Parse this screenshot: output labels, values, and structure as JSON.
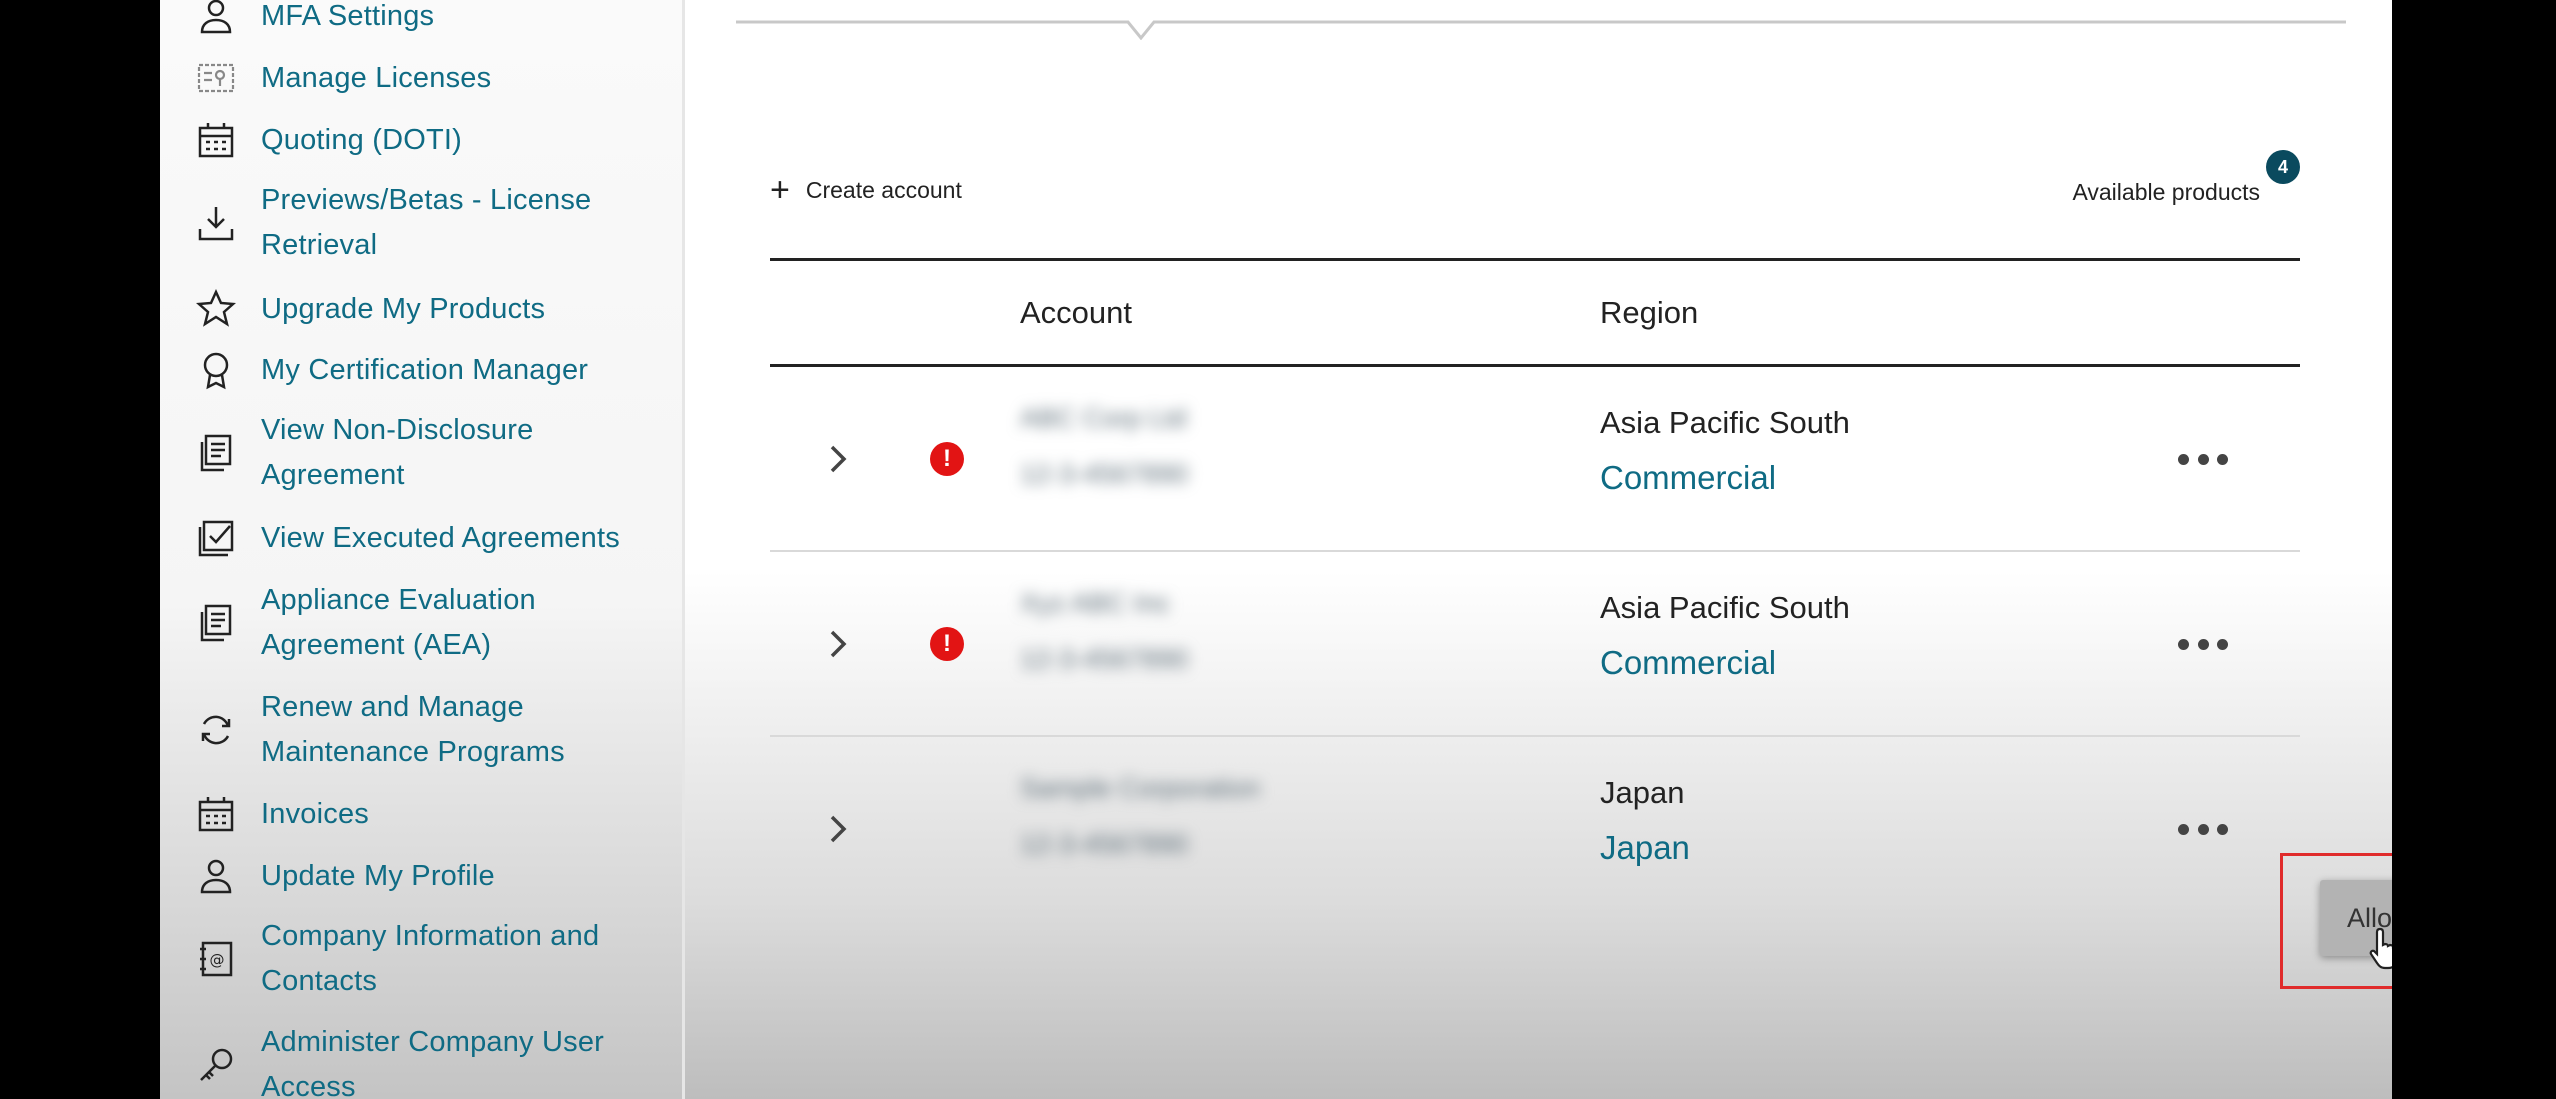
{
  "sidebar": {
    "items": [
      {
        "label": "MFA Settings",
        "icon": "user-icon"
      },
      {
        "label": "Manage Licenses",
        "icon": "license-icon"
      },
      {
        "label": "Quoting (DOTI)",
        "icon": "calculator-icon"
      },
      {
        "label": "Previews/Betas - License Retrieval",
        "icon": "download-icon"
      },
      {
        "label": "Upgrade My Products",
        "icon": "star-icon"
      },
      {
        "label": "My Certification Manager",
        "icon": "award-icon"
      },
      {
        "label": "View Non-Disclosure Agreement",
        "icon": "document-icon"
      },
      {
        "label": "View Executed Agreements",
        "icon": "checkbox-icon"
      },
      {
        "label": "Appliance Evaluation Agreement (AEA)",
        "icon": "document-icon"
      },
      {
        "label": "Renew and Manage Maintenance Programs",
        "icon": "refresh-icon"
      },
      {
        "label": "Invoices",
        "icon": "calculator-icon"
      },
      {
        "label": "Update My Profile",
        "icon": "user-icon"
      },
      {
        "label": "Company Information and Contacts",
        "icon": "contacts-icon"
      },
      {
        "label": "Administer Company User Access",
        "icon": "key-icon"
      }
    ]
  },
  "toolbar": {
    "create_account": "Create account",
    "available_products": "Available products",
    "products_count": "4"
  },
  "table": {
    "headers": {
      "account": "Account",
      "region": "Region"
    },
    "rows": [
      {
        "account_name": "ABC Corp Ltd",
        "account_id": "12-3-4567890",
        "region": "Asia Pacific South",
        "type": "Commercial",
        "has_alert": true
      },
      {
        "account_name": "Xyz ABC Inc",
        "account_id": "12-3-4567890",
        "region": "Asia Pacific South",
        "type": "Commercial",
        "has_alert": true
      },
      {
        "account_name": "Sample Corporation",
        "account_id": "12-3-4567890",
        "region": "Japan",
        "type": "Japan",
        "has_alert": false
      }
    ]
  },
  "menu": {
    "allocate": "Allocate"
  },
  "colors": {
    "link": "#0f6b84",
    "alert": "#e21414",
    "badge": "#0a4a5e",
    "highlight": "#e02b2b"
  }
}
